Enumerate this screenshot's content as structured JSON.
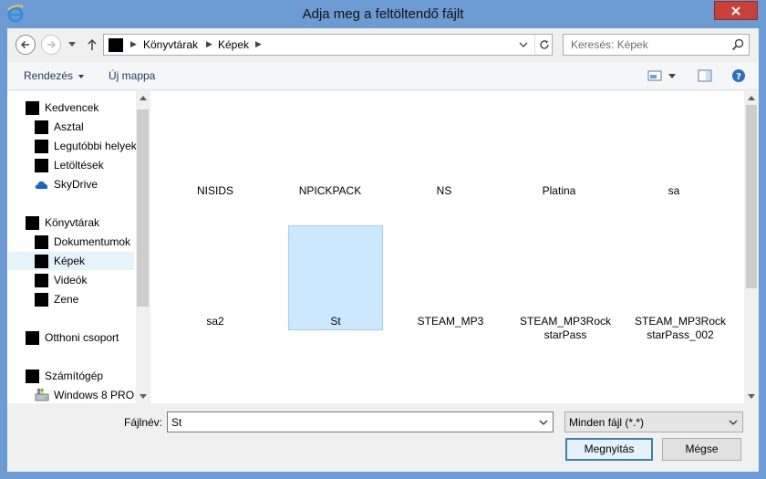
{
  "window": {
    "title": "Adja meg a feltöltendő fájlt"
  },
  "address": {
    "crumbs": [
      "Könyvtárak",
      "Képek"
    ]
  },
  "search": {
    "placeholder": "Keresés: Képek"
  },
  "toolbar": {
    "organize_label": "Rendezés",
    "new_folder_label": "Új mappa"
  },
  "sidebar": {
    "favorites": "Kedvencek",
    "desktop": "Asztal",
    "recent": "Legutóbbi helyek",
    "downloads": "Letöltések",
    "skydrive": "SkyDrive",
    "libraries": "Könyvtárak",
    "documents": "Dokumentumok",
    "pictures": "Képek",
    "videos": "Videók",
    "music": "Zene",
    "homegroup": "Otthoni csoport",
    "computer": "Számítógép",
    "windows": "Windows 8 PRO ("
  },
  "files": {
    "f1": "NISIDS",
    "f2": "NPICKPACK",
    "f3": "NS",
    "f4": "Platina",
    "f5": "sa",
    "f6": "sa2",
    "f7": "St",
    "f8": "STEAM_MP3",
    "f9a": "STEAM_MP3Rock",
    "f9b": "starPass",
    "f10a": "STEAM_MP3Rock",
    "f10b": "starPass_002"
  },
  "bottom": {
    "filename_label": "Fájlnév:",
    "filename_value": "St",
    "filter_value": "Minden fájl (*.*)",
    "open_label": "Megnyitás",
    "cancel_label": "Mégse"
  },
  "colors": {
    "frame": "#6c9bd3",
    "selection": "#cce8ff",
    "close": "#c7403a"
  }
}
